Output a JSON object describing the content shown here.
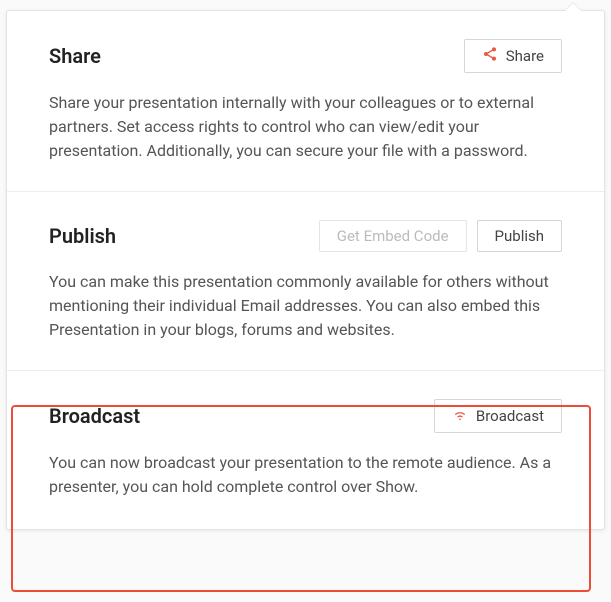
{
  "sections": {
    "share": {
      "title": "Share",
      "button_label": "Share",
      "description": "Share your presentation internally with your colleagues or to external partners. Set access rights to control who can view/edit your presentation. Additionally, you can secure your file with a password."
    },
    "publish": {
      "title": "Publish",
      "embed_button_label": "Get Embed Code",
      "publish_button_label": "Publish",
      "description": "You can make this presentation commonly available for others without mentioning their individual Email addresses. You can also embed this Presentation in your blogs, forums and websites."
    },
    "broadcast": {
      "title": "Broadcast",
      "button_label": "Broadcast",
      "description": "You can now broadcast your presentation to the remote audience. As a presenter, you can hold complete control over Show."
    }
  }
}
